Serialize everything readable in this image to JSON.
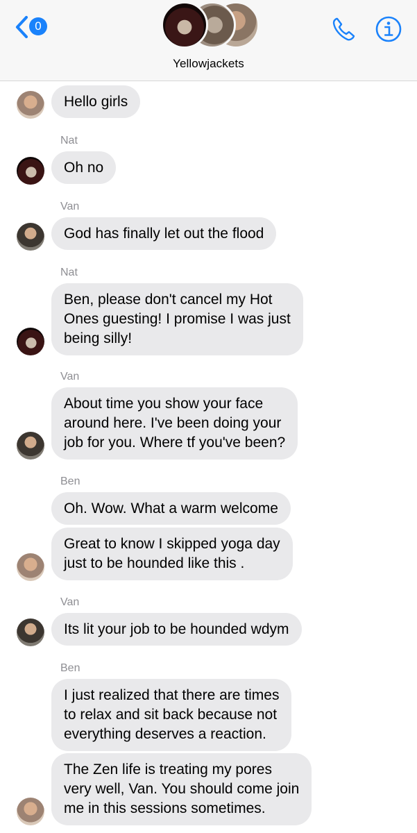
{
  "header": {
    "unread_count": "0",
    "group_name": "Yellowjackets",
    "accent_color": "#1a82fb"
  },
  "icons": [
    "chevron-left-icon",
    "phone-icon",
    "info-icon"
  ],
  "messages": [
    {
      "sender": "",
      "avatar": "ben",
      "lines": [
        "Hello girls"
      ]
    },
    {
      "sender": "Nat",
      "avatar": "nat",
      "lines": [
        "Oh no"
      ]
    },
    {
      "sender": "Van",
      "avatar": "van",
      "lines": [
        "God has finally let out the flood"
      ]
    },
    {
      "sender": "Nat",
      "avatar": "nat",
      "lines": [
        "Ben, please don't cancel my Hot",
        "Ones guesting! I promise I was just",
        "being silly!"
      ]
    },
    {
      "sender": "Van",
      "avatar": "van",
      "lines": [
        "About time you show your face",
        "around here. I've been doing your",
        "job for you. Where tf you've been?"
      ]
    },
    {
      "sender": "Ben",
      "avatar": "",
      "lines": [
        "Oh. Wow. What a warm welcome"
      ]
    },
    {
      "sender": "",
      "avatar": "ben",
      "lines": [
        "Great to know I skipped yoga day",
        "just to be hounded like this ."
      ]
    },
    {
      "sender": "Van",
      "avatar": "van",
      "lines": [
        "Its lit your job to be hounded wdym"
      ]
    },
    {
      "sender": "Ben",
      "avatar": "",
      "lines": [
        "I just realized that there are times",
        "to relax and sit back because not",
        "everything deserves a reaction."
      ]
    },
    {
      "sender": "",
      "avatar": "ben",
      "lines": [
        "The Zen life is treating my pores",
        "very well, Van. You should come join",
        "me in this sessions sometimes."
      ]
    }
  ]
}
